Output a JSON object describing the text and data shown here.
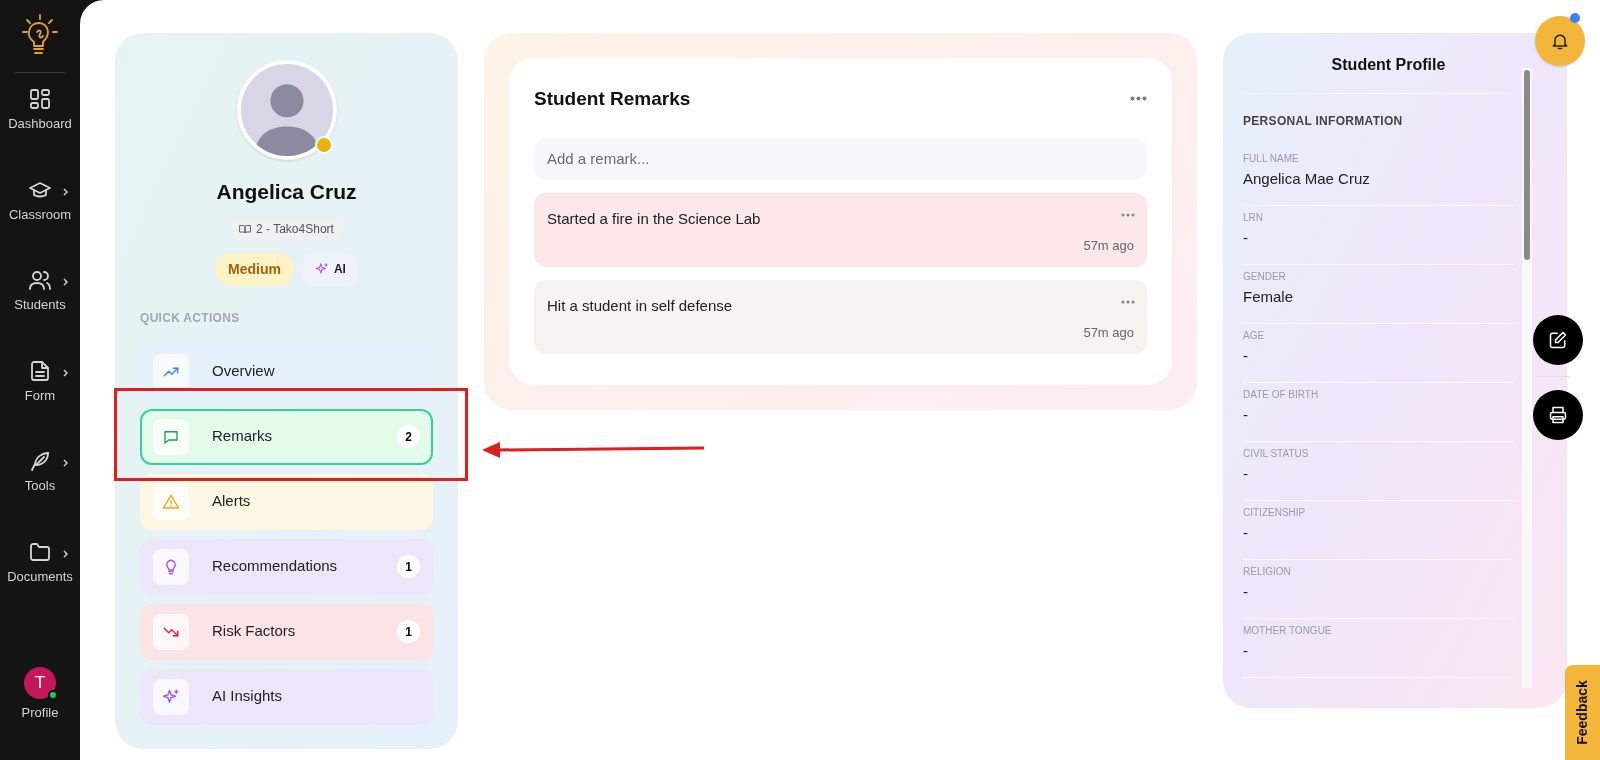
{
  "nav": {
    "items": [
      {
        "label": "Dashboard",
        "kind": "dashboard",
        "submenu": false
      },
      {
        "label": "Classroom",
        "kind": "classroom",
        "submenu": true
      },
      {
        "label": "Students",
        "kind": "students",
        "submenu": true
      },
      {
        "label": "Form",
        "kind": "form",
        "submenu": true
      },
      {
        "label": "Tools",
        "kind": "tools",
        "submenu": true
      },
      {
        "label": "Documents",
        "kind": "documents",
        "submenu": true
      }
    ],
    "profile": {
      "initial": "T",
      "label": "Profile",
      "online": true
    }
  },
  "student": {
    "name": "Angelica Cruz",
    "class": "2 - Tako4Short",
    "risk": "Medium",
    "ai_badge": "AI"
  },
  "quick_actions": {
    "title": "QUICK ACTIONS",
    "items": [
      {
        "label": "Overview",
        "kind": "overview",
        "selected": false
      },
      {
        "label": "Remarks",
        "kind": "remarks",
        "count": "2",
        "selected": true
      },
      {
        "label": "Alerts",
        "kind": "alerts",
        "selected": false
      },
      {
        "label": "Recommendations",
        "kind": "recommendations",
        "count": "1",
        "selected": false
      },
      {
        "label": "Risk Factors",
        "kind": "risk",
        "count": "1",
        "selected": false
      },
      {
        "label": "AI Insights",
        "kind": "insights",
        "selected": false
      }
    ]
  },
  "remarks": {
    "title": "Student Remarks",
    "placeholder": "Add a remark...",
    "items": [
      {
        "text": "Started a fire in the Science Lab",
        "time": "57m ago",
        "color": "#fbe7e7"
      },
      {
        "text": "Hit a student in self defense",
        "time": "57m ago",
        "color": "#f4f3f0"
      }
    ]
  },
  "profile_panel": {
    "title": "Student Profile",
    "section": "PERSONAL INFORMATION",
    "fields": [
      {
        "label": "FULL NAME",
        "value": "Angelica Mae Cruz"
      },
      {
        "label": "LRN",
        "value": "-"
      },
      {
        "label": "GENDER",
        "value": "Female"
      },
      {
        "label": "AGE",
        "value": "-"
      },
      {
        "label": "DATE OF BIRTH",
        "value": "-"
      },
      {
        "label": "CIVIL STATUS",
        "value": "-"
      },
      {
        "label": "CITIZENSHIP",
        "value": "-"
      },
      {
        "label": "RELIGION",
        "value": "-"
      },
      {
        "label": "MOTHER TONGUE",
        "value": "-"
      }
    ]
  },
  "notifications": {
    "unread": true
  },
  "feedback": {
    "label": "Feedback"
  }
}
